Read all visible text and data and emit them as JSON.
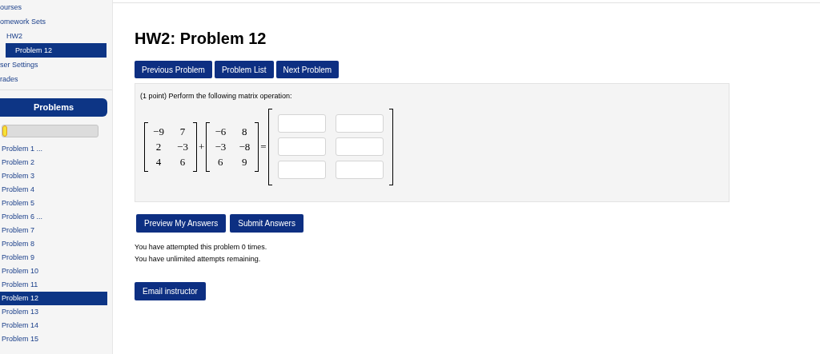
{
  "nav": [
    {
      "label": "ourses",
      "selected": false
    },
    {
      "label": "omework Sets",
      "selected": false,
      "children": [
        {
          "label": "HW2",
          "selected": false,
          "children": [
            {
              "label": "Problem 12",
              "selected": true
            }
          ]
        }
      ]
    },
    {
      "label": "ser Settings",
      "selected": false
    },
    {
      "label": "rades",
      "selected": false
    }
  ],
  "problems_panel": {
    "title": "Problems",
    "progress": {
      "level": 0.02
    },
    "items": [
      {
        "label": "Problem 1 ...",
        "selected": false
      },
      {
        "label": "Problem 2",
        "selected": false
      },
      {
        "label": "Problem 3",
        "selected": false
      },
      {
        "label": "Problem 4",
        "selected": false
      },
      {
        "label": "Problem 5",
        "selected": false
      },
      {
        "label": "Problem 6 ...",
        "selected": false
      },
      {
        "label": "Problem 7",
        "selected": false
      },
      {
        "label": "Problem 8",
        "selected": false
      },
      {
        "label": "Problem 9",
        "selected": false
      },
      {
        "label": "Problem 10",
        "selected": false
      },
      {
        "label": "Problem 11",
        "selected": false
      },
      {
        "label": "Problem 12",
        "selected": true
      },
      {
        "label": "Problem 13",
        "selected": false
      },
      {
        "label": "Problem 14",
        "selected": false
      },
      {
        "label": "Problem 15",
        "selected": false
      }
    ]
  },
  "title": "HW2: Problem 12",
  "nav_buttons": [
    "Previous Problem",
    "Problem List",
    "Next Problem"
  ],
  "problem": {
    "prompt": "(1 point) Perform the following matrix operation:",
    "matrix_a": [
      [
        "−9",
        "7"
      ],
      [
        "2",
        "−3"
      ],
      [
        "4",
        "6"
      ]
    ],
    "operator": "+",
    "matrix_b": [
      [
        "−6",
        "8"
      ],
      [
        "−3",
        "−8"
      ],
      [
        "6",
        "9"
      ]
    ],
    "equals": "="
  },
  "action_buttons": [
    "Preview My Answers",
    "Submit Answers"
  ],
  "attempts": [
    "You have attempted this problem 0 times.",
    "You have unlimited attempts remaining."
  ],
  "email_button": "Email instructor"
}
